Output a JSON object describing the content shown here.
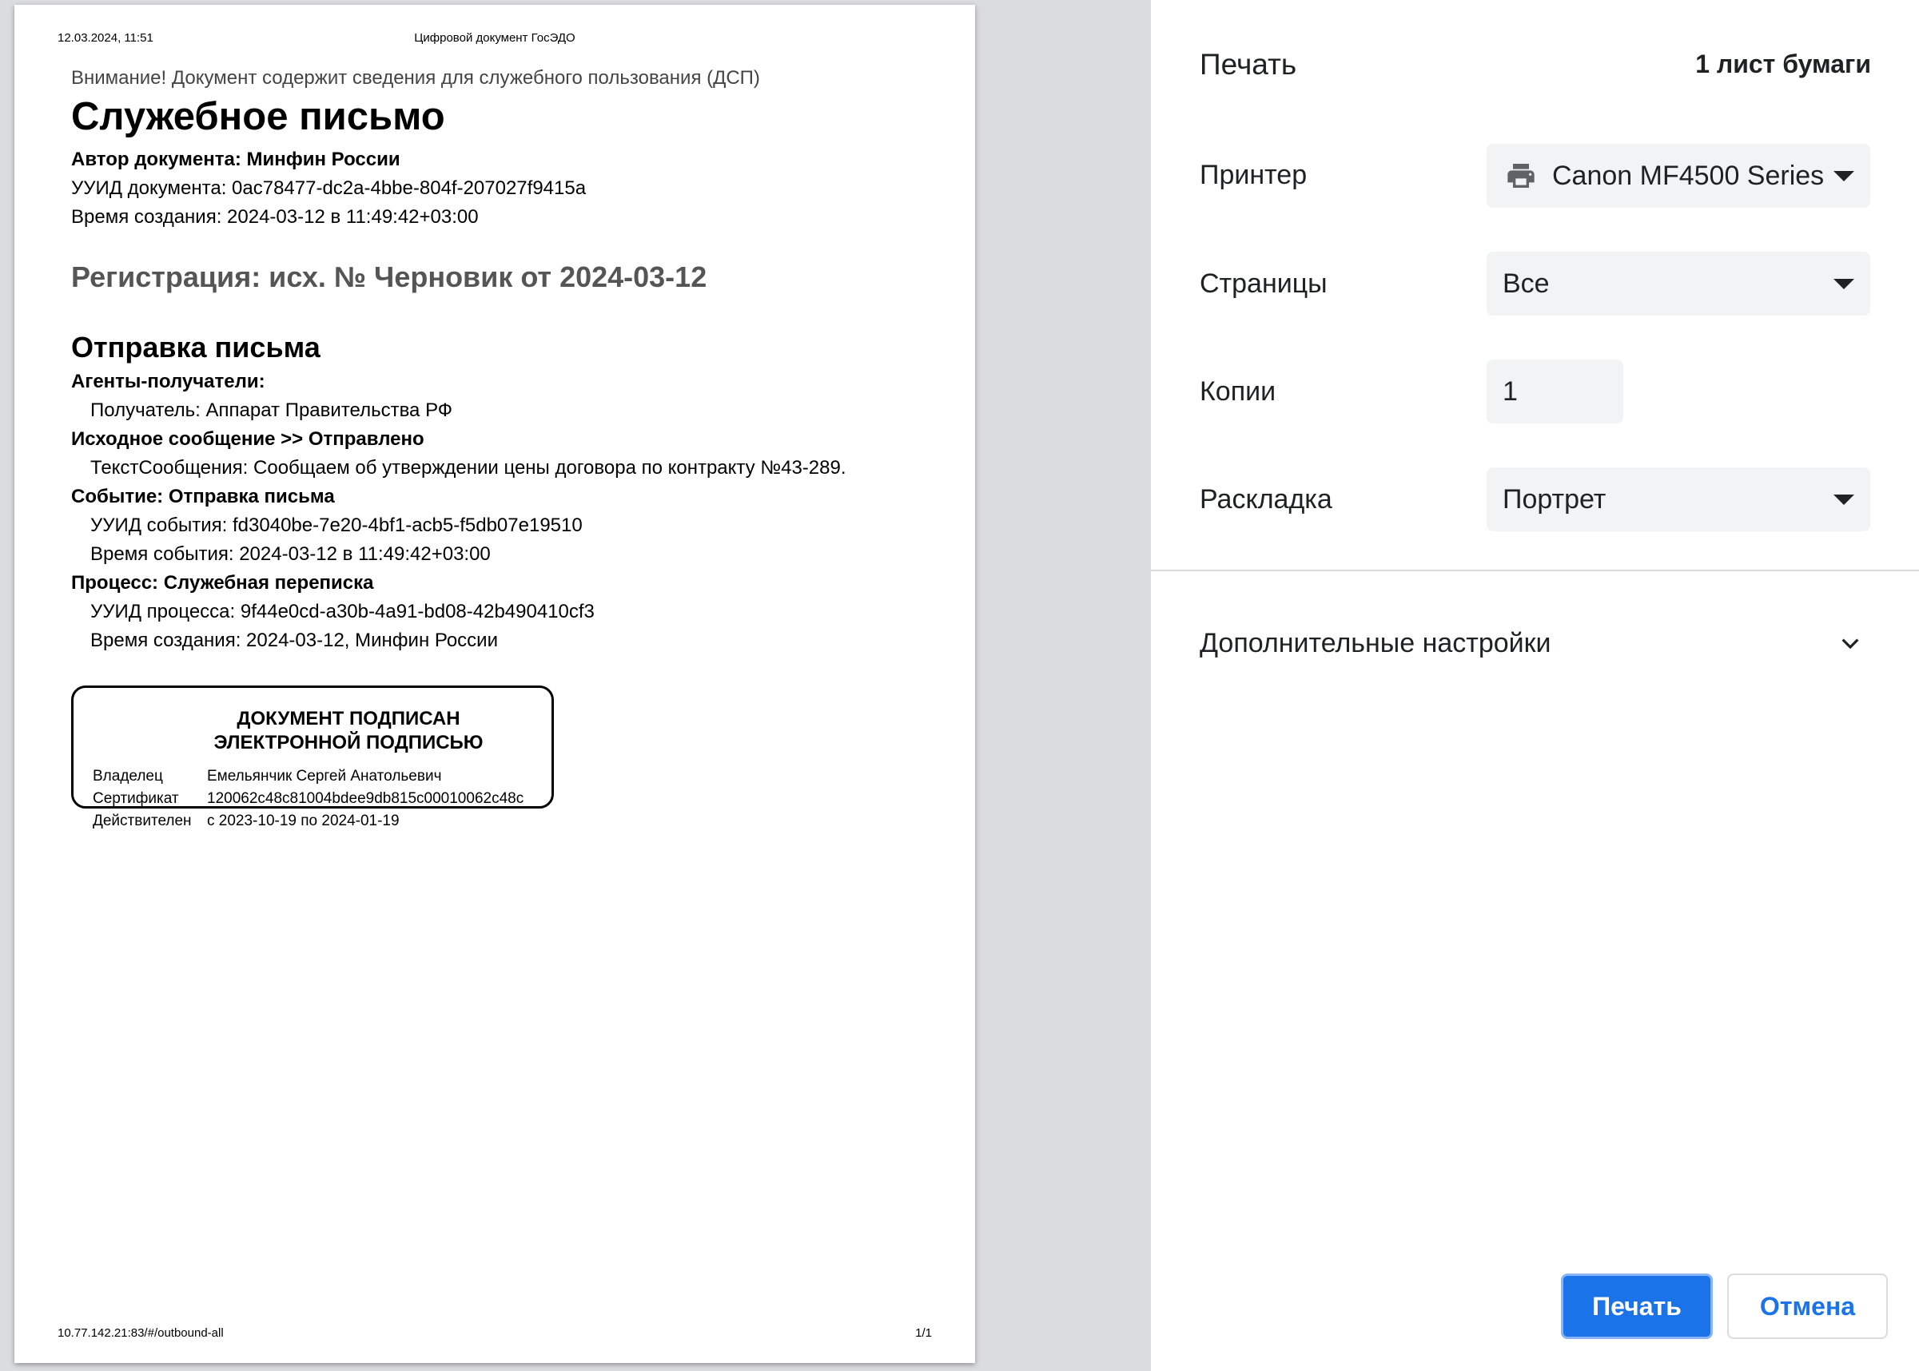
{
  "preview": {
    "header_date": "12.03.2024, 11:51",
    "header_title": "Цифровой документ ГосЭДО",
    "footer_url": "10.77.142.21:83/#/outbound-all",
    "footer_page": "1/1",
    "document": {
      "warning": "Внимание! Документ содержит сведения для служебного пользования (ДСП)",
      "title": "Служебное письмо",
      "author": "Автор документа: Минфин России",
      "uuid": "УУИД документа: 0ac78477-dc2a-4bbe-804f-207027f9415a",
      "created": "Время создания: 2024-03-12 в 11:49:42+03:00",
      "registration": "Регистрация: исх. № Черновик от 2024-03-12",
      "section_title": "Отправка письма",
      "agents_label": "Агенты-получатели:",
      "recipient": "Получатель: Аппарат Правительства РФ",
      "source_message": "Исходное сообщение >> Отправлено",
      "message_text": "ТекстСообщения: Сообщаем об утверждении цены договора по контракту №43-289.",
      "event_label": "Событие: Отправка письма",
      "event_uuid": "УУИД события: fd3040be-7e20-4bf1-acb5-f5db07e19510",
      "event_time": "Время события: 2024-03-12 в 11:49:42+03:00",
      "process_label": "Процесс: Служебная переписка",
      "process_uuid": "УУИД процесса: 9f44e0cd-a30b-4a91-bd08-42b490410cf3",
      "process_created": "Время создания: 2024-03-12, Минфин России"
    },
    "signature": {
      "heading_line1": "ДОКУМЕНТ ПОДПИСАН",
      "heading_line2": "ЭЛЕКТРОННОЙ ПОДПИСЬЮ",
      "owner_key": "Владелец",
      "owner_value": "Емельянчик Сергей Анатольевич",
      "cert_key": "Сертификат",
      "cert_value": "120062c48c81004bdee9db815c00010062c48c",
      "valid_key": "Действителен",
      "valid_value": "с 2023-10-19 по 2024-01-19"
    }
  },
  "settings": {
    "title": "Печать",
    "sheet_count": "1 лист бумаги",
    "printer_label": "Принтер",
    "printer_value": "Canon MF4500 Series",
    "pages_label": "Страницы",
    "pages_value": "Все",
    "copies_label": "Копии",
    "copies_value": "1",
    "layout_label": "Раскладка",
    "layout_value": "Портрет",
    "more_settings_label": "Дополнительные настройки",
    "print_button": "Печать",
    "cancel_button": "Отмена",
    "colors": {
      "accent": "#1a73e8",
      "field_bg": "#f1f3f4",
      "preview_bg": "#dadce0"
    }
  }
}
